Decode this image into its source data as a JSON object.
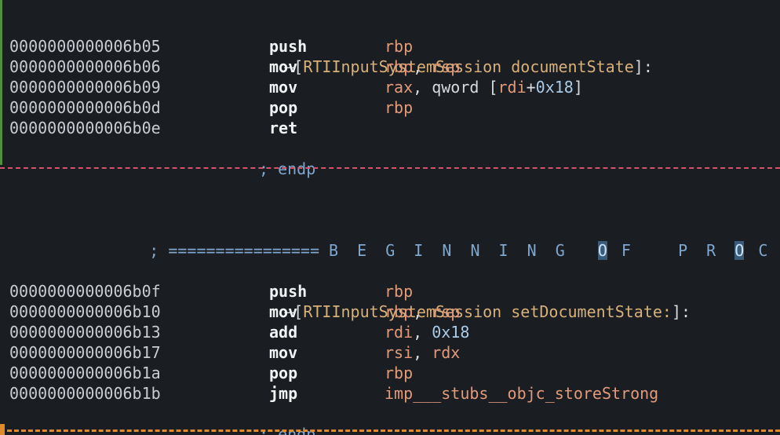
{
  "colors": {
    "background": "#1a1d21",
    "address": "#c9cdd2",
    "mnemonic": "#f1f2f4",
    "register": "#e39a7a",
    "number": "#a9cbe8",
    "procedure_name": "#d8b07a",
    "comment": "#7fa7cf",
    "separator_red": "#d2546a",
    "separator_orange": "#e08a2a",
    "gutter_green": "#4f8f3f"
  },
  "proc1": {
    "header_prefix": "–[",
    "header_name": "RTIInputSystemSession documentState",
    "header_suffix": "]:",
    "instructions": [
      {
        "addr": "0000000000006b05",
        "mnem": "push",
        "ops": [
          {
            "t": "rbp",
            "k": "reg"
          }
        ]
      },
      {
        "addr": "0000000000006b06",
        "mnem": "mov",
        "ops": [
          {
            "t": "rbp",
            "k": "reg"
          },
          {
            "t": ", ",
            "k": "punc"
          },
          {
            "t": "rsp",
            "k": "reg"
          }
        ]
      },
      {
        "addr": "0000000000006b09",
        "mnem": "mov",
        "ops": [
          {
            "t": "rax",
            "k": "reg"
          },
          {
            "t": ", qword [",
            "k": "punc"
          },
          {
            "t": "rdi",
            "k": "reg"
          },
          {
            "t": "+",
            "k": "punc"
          },
          {
            "t": "0x18",
            "k": "num"
          },
          {
            "t": "]",
            "k": "punc"
          }
        ]
      },
      {
        "addr": "0000000000006b0d",
        "mnem": "pop",
        "ops": [
          {
            "t": "rbp",
            "k": "reg"
          }
        ]
      },
      {
        "addr": "0000000000006b0e",
        "mnem": "ret",
        "ops": []
      }
    ],
    "endp": "; endp"
  },
  "banner": {
    "prefix": "; ================ ",
    "text_a": "B E G I N N I N G  ",
    "hl1": "O",
    "text_b": " F   P R ",
    "hl2": "O",
    "text_c": " C E D U R E ================"
  },
  "proc2": {
    "header_prefix": "–[",
    "header_name": "RTIInputSystemSession setDocumentState:",
    "header_suffix": "]:",
    "instructions": [
      {
        "addr": "0000000000006b0f",
        "mnem": "push",
        "ops": [
          {
            "t": "rbp",
            "k": "reg"
          }
        ]
      },
      {
        "addr": "0000000000006b10",
        "mnem": "mov",
        "ops": [
          {
            "t": "rbp",
            "k": "reg"
          },
          {
            "t": ", ",
            "k": "punc"
          },
          {
            "t": "rsp",
            "k": "reg"
          }
        ]
      },
      {
        "addr": "0000000000006b13",
        "mnem": "add",
        "ops": [
          {
            "t": "rdi",
            "k": "reg"
          },
          {
            "t": ", ",
            "k": "punc"
          },
          {
            "t": "0x18",
            "k": "num"
          }
        ]
      },
      {
        "addr": "0000000000006b17",
        "mnem": "mov",
        "ops": [
          {
            "t": "rsi",
            "k": "reg"
          },
          {
            "t": ", ",
            "k": "punc"
          },
          {
            "t": "rdx",
            "k": "reg"
          }
        ]
      },
      {
        "addr": "0000000000006b1a",
        "mnem": "pop",
        "ops": [
          {
            "t": "rbp",
            "k": "reg"
          }
        ]
      },
      {
        "addr": "0000000000006b1b",
        "mnem": "jmp",
        "ops": [
          {
            "t": "imp___stubs__objc_storeStrong",
            "k": "sym"
          }
        ]
      }
    ],
    "endp": "; endp"
  }
}
